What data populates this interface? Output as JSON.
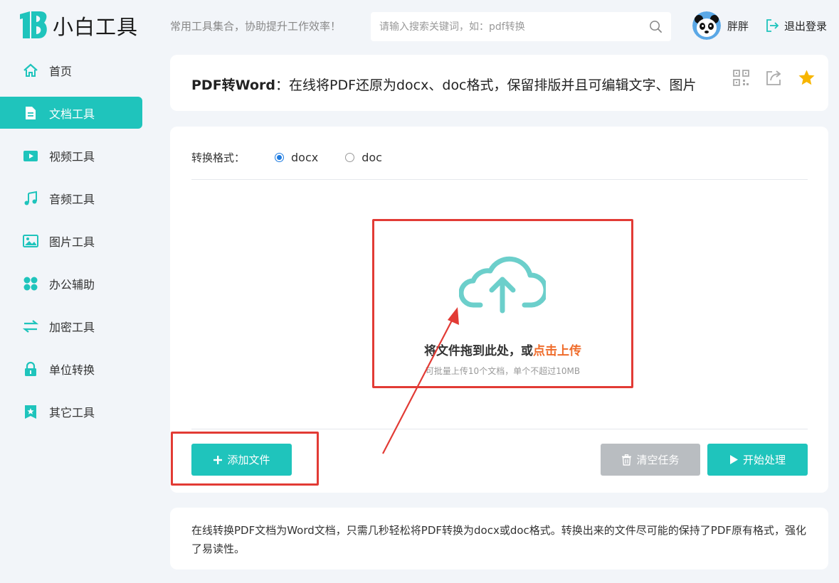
{
  "brand": {
    "name": "小白工具",
    "slogan": "常用工具集合，协助提升工作效率！"
  },
  "search": {
    "placeholder": "请输入搜索关键词，如：pdf转换",
    "value": ""
  },
  "user": {
    "name": "胖胖",
    "logout_label": "退出登录"
  },
  "sidebar": {
    "items": [
      {
        "label": "首页",
        "icon": "home-icon"
      },
      {
        "label": "文档工具",
        "icon": "document-icon",
        "active": true
      },
      {
        "label": "视频工具",
        "icon": "video-icon"
      },
      {
        "label": "音频工具",
        "icon": "music-icon"
      },
      {
        "label": "图片工具",
        "icon": "image-icon"
      },
      {
        "label": "办公辅助",
        "icon": "grid-icon"
      },
      {
        "label": "加密工具",
        "icon": "swap-icon"
      },
      {
        "label": "单位转换",
        "icon": "lock-icon"
      },
      {
        "label": "其它工具",
        "icon": "star-bookmark-icon"
      }
    ]
  },
  "page": {
    "title_bold": "PDF转Word",
    "title_rest": "：在线将PDF还原为docx、doc格式，保留排版并且可编辑文字、图片",
    "actions": [
      "qrcode-icon",
      "share-icon",
      "favorite-star-icon"
    ]
  },
  "converter": {
    "format_label": "转换格式：",
    "options": [
      {
        "label": "docx",
        "checked": true
      },
      {
        "label": "doc",
        "checked": false
      }
    ],
    "drop_text": "将文件拖到此处，或",
    "drop_link": "点击上传",
    "drop_hint": "可批量上传10个文档，单个不超过10MB",
    "add_button": "添加文件",
    "clear_button": "清空任务",
    "start_button": "开始处理"
  },
  "description": "在线转换PDF文档为Word文档，只需几秒轻松将PDF转换为docx或doc格式。转换出来的文件尽可能的保持了PDF原有格式，强化了易读性。",
  "colors": {
    "accent": "#1fc4bc",
    "highlight": "#e23b35",
    "link": "#ef6c2b",
    "disabled": "#b9bdc1"
  }
}
